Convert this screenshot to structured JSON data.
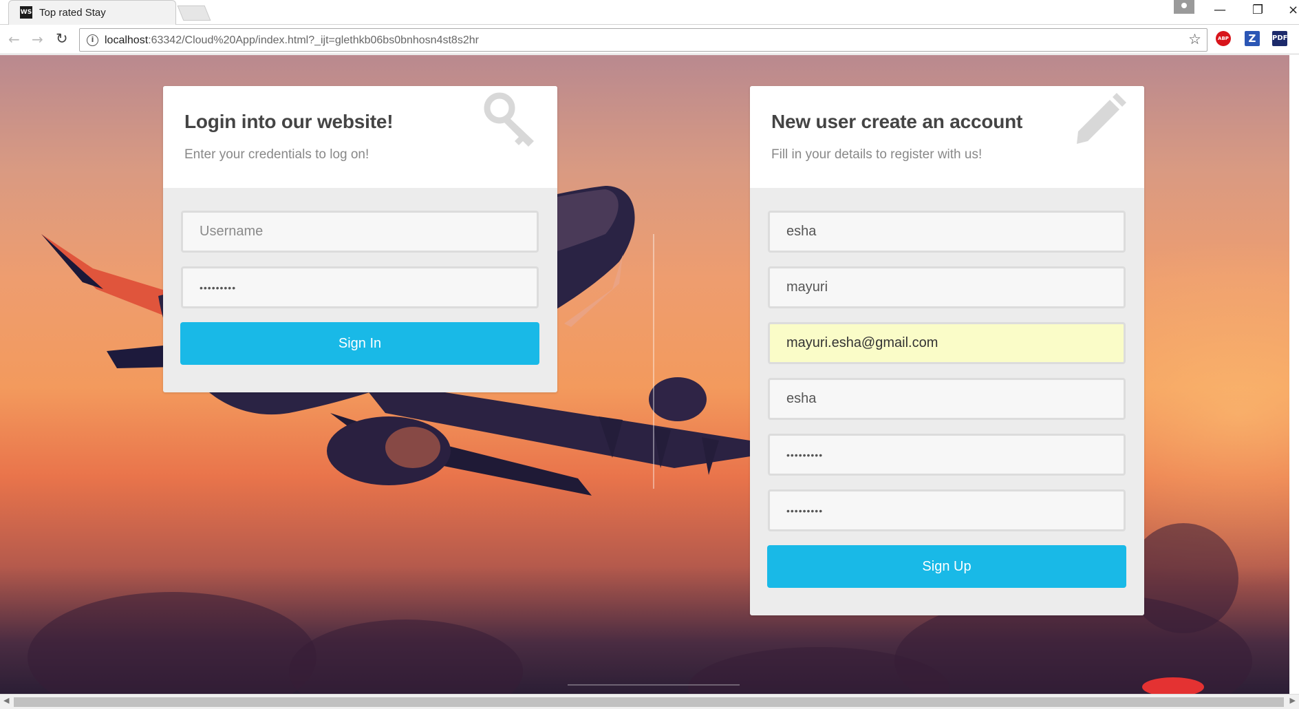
{
  "browser": {
    "tab_title": "Top rated Stay",
    "tab_favicon": "WS",
    "tab_close": "×",
    "url_host": "localhost",
    "url_path": ":63342/Cloud%20App/index.html?_ijt=glethkb06bs0bnhosn4st8s2hr",
    "extensions": {
      "abp": "ABP",
      "z": "Z",
      "pdf": "PDF"
    }
  },
  "icons": {
    "back": "←",
    "forward": "→",
    "reload": "↻",
    "info": "i",
    "star": "☆",
    "minimize": "—",
    "restore": "❐",
    "close_window": "×",
    "scroll_left": "◀",
    "scroll_right": "▶",
    "login_card_icon": "key-icon",
    "register_card_icon": "pencil-icon"
  },
  "login": {
    "title": "Login into our website!",
    "subtitle": "Enter your credentials to log on!",
    "username_placeholder": "Username",
    "username_value": "",
    "password_value": "•••••••••",
    "button": "Sign In"
  },
  "register": {
    "title": "New user create an account",
    "subtitle": "Fill in your details to register with us!",
    "first_name": "esha",
    "last_name": "mayuri",
    "email": "mayuri.esha@gmail.com",
    "username": "esha",
    "password": "•••••••••",
    "confirm_password": "•••••••••",
    "button": "Sign Up"
  },
  "colors": {
    "accent": "#19b9e7",
    "autofill": "#fafcc8",
    "card_body": "#ececec",
    "heading": "#444444"
  }
}
